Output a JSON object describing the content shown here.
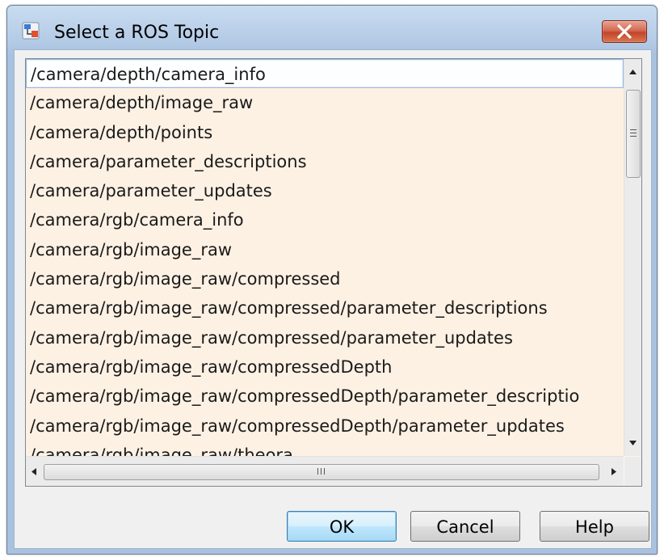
{
  "window": {
    "title": "Select a ROS Topic",
    "icon": "simulink-app-icon",
    "close_icon": "close-icon"
  },
  "topics": {
    "items": [
      "/camera/depth/camera_info",
      "/camera/depth/image_raw",
      "/camera/depth/points",
      "/camera/parameter_descriptions",
      "/camera/parameter_updates",
      "/camera/rgb/camera_info",
      "/camera/rgb/image_raw",
      "/camera/rgb/image_raw/compressed",
      "/camera/rgb/image_raw/compressed/parameter_descriptions",
      "/camera/rgb/image_raw/compressed/parameter_updates",
      "/camera/rgb/image_raw/compressedDepth",
      "/camera/rgb/image_raw/compressedDepth/parameter_descriptio",
      "/camera/rgb/image_raw/compressedDepth/parameter_updates",
      "/camera/rgb/image_raw/theora"
    ],
    "selected_index": 0
  },
  "buttons": {
    "ok": "OK",
    "cancel": "Cancel",
    "help": "Help"
  },
  "colors": {
    "list_background": "#fdf1e4",
    "selection_border": "#9bb9de",
    "default_button": "#bee6fd",
    "close_button": "#c2452b"
  }
}
